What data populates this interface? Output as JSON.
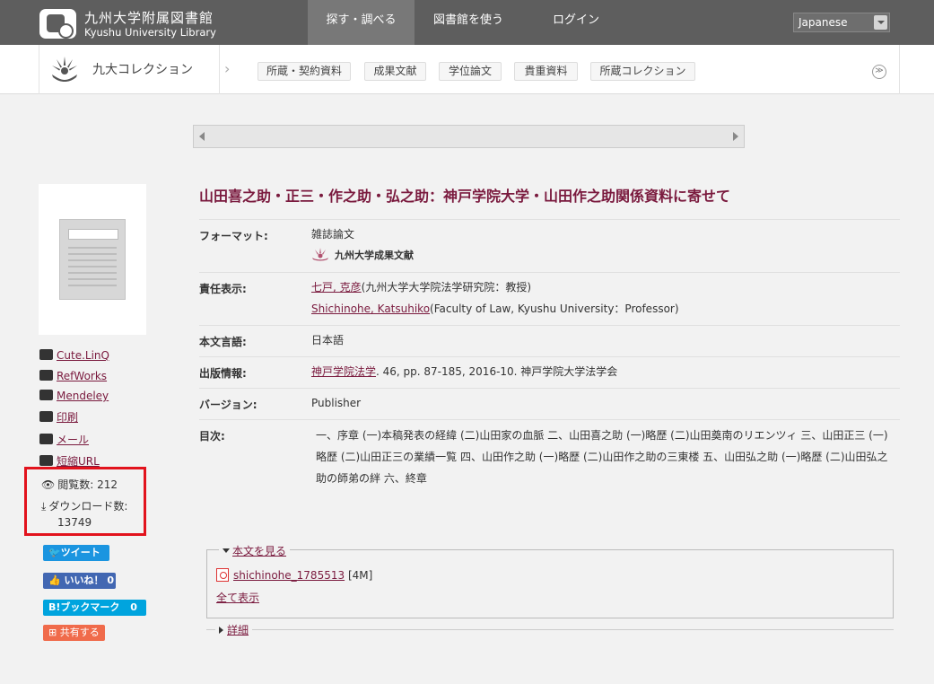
{
  "header": {
    "library_name_ja": "九州大学附属図書館",
    "library_name_en": "Kyushu University Library",
    "nav": [
      "探す・調べる",
      "図書館を使う",
      "ログイン"
    ],
    "language": "Japanese"
  },
  "collection_bar": {
    "title": "九大コレクション",
    "tabs": [
      "所蔵・契約資料",
      "成果文献",
      "学位論文",
      "貴重資料",
      "所蔵コレクション"
    ],
    "more": "≫"
  },
  "sidebar": {
    "links": [
      "Cute.LinQ",
      "RefWorks",
      "Mendeley",
      "印刷",
      "メール",
      "短縮URL"
    ],
    "views_label": "閲覧数:",
    "views_value": "212",
    "downloads_label": "ダウンロード数:",
    "downloads_value": "13749",
    "share": {
      "tweet": "ツイート",
      "like": "いいね！",
      "like_count": "0",
      "bookmark": "ブックマーク",
      "bookmark_count": "0",
      "share": "共有する"
    }
  },
  "record": {
    "title": "山田喜之助・正三・作之助・弘之助：神戸学院大学・山田作之助関係資料に寄せて",
    "format_label": "フォーマット:",
    "format_value": "雑誌論文",
    "format_source": "九州大学成果文献",
    "author_label": "責任表示:",
    "author1_link": "七戸, 克彦",
    "author1_rest": "(九州大学大学院法学研究院：教授)",
    "author2_link": "Shichinohe, Katsuhiko",
    "author2_rest": "(Faculty of Law, Kyushu University：Professor)",
    "lang_label": "本文言語:",
    "lang_value": "日本語",
    "pub_label": "出版情報:",
    "pub_link": "神戸学院法学",
    "pub_rest": ". 46, pp. 87-185, 2016-10. 神戸学院大学法学会",
    "version_label": "バージョン:",
    "version_value": "Publisher",
    "toc_label": "目次:",
    "toc_value": "一、序章 (一)本稿発表の経緯 (二)山田家の血脈 二、山田喜之助 (一)略歴 (二)山田奠南のリエンツィ 三、山田正三 (一)略歴 (二)山田正三の業績一覧 四、山田作之助 (一)略歴 (二)山田作之助の三東楼 五、山田弘之助 (一)略歴 (二)山田弘之助の師弟の絆 六、終章"
  },
  "fulltext": {
    "heading": "本文を見る",
    "file_name": "shichinohe_1785513",
    "file_size": "[4M]",
    "show_all": "全て表示",
    "details": "詳細"
  },
  "colors": {
    "accent": "#7a1a3e",
    "header_bg": "#5e5e5e",
    "highlight_box": "#e2131d",
    "twitter": "#1b95e0",
    "facebook": "#4267b2",
    "hatena": "#00a4de",
    "share": "#f06b4b"
  }
}
